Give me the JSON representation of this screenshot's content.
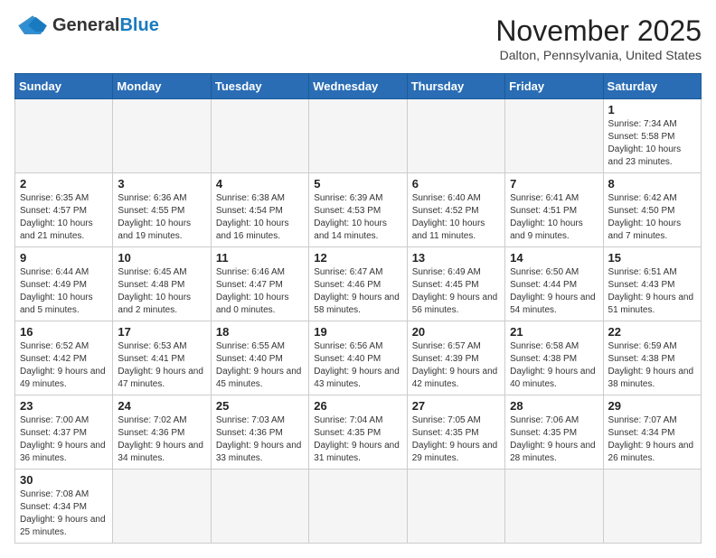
{
  "header": {
    "logo_general": "General",
    "logo_blue": "Blue",
    "month_title": "November 2025",
    "location": "Dalton, Pennsylvania, United States"
  },
  "weekdays": [
    "Sunday",
    "Monday",
    "Tuesday",
    "Wednesday",
    "Thursday",
    "Friday",
    "Saturday"
  ],
  "weeks": [
    [
      {
        "day": "",
        "info": ""
      },
      {
        "day": "",
        "info": ""
      },
      {
        "day": "",
        "info": ""
      },
      {
        "day": "",
        "info": ""
      },
      {
        "day": "",
        "info": ""
      },
      {
        "day": "",
        "info": ""
      },
      {
        "day": "1",
        "info": "Sunrise: 7:34 AM\nSunset: 5:58 PM\nDaylight: 10 hours and 23 minutes."
      }
    ],
    [
      {
        "day": "2",
        "info": "Sunrise: 6:35 AM\nSunset: 4:57 PM\nDaylight: 10 hours and 21 minutes."
      },
      {
        "day": "3",
        "info": "Sunrise: 6:36 AM\nSunset: 4:55 PM\nDaylight: 10 hours and 19 minutes."
      },
      {
        "day": "4",
        "info": "Sunrise: 6:38 AM\nSunset: 4:54 PM\nDaylight: 10 hours and 16 minutes."
      },
      {
        "day": "5",
        "info": "Sunrise: 6:39 AM\nSunset: 4:53 PM\nDaylight: 10 hours and 14 minutes."
      },
      {
        "day": "6",
        "info": "Sunrise: 6:40 AM\nSunset: 4:52 PM\nDaylight: 10 hours and 11 minutes."
      },
      {
        "day": "7",
        "info": "Sunrise: 6:41 AM\nSunset: 4:51 PM\nDaylight: 10 hours and 9 minutes."
      },
      {
        "day": "8",
        "info": "Sunrise: 6:42 AM\nSunset: 4:50 PM\nDaylight: 10 hours and 7 minutes."
      }
    ],
    [
      {
        "day": "9",
        "info": "Sunrise: 6:44 AM\nSunset: 4:49 PM\nDaylight: 10 hours and 5 minutes."
      },
      {
        "day": "10",
        "info": "Sunrise: 6:45 AM\nSunset: 4:48 PM\nDaylight: 10 hours and 2 minutes."
      },
      {
        "day": "11",
        "info": "Sunrise: 6:46 AM\nSunset: 4:47 PM\nDaylight: 10 hours and 0 minutes."
      },
      {
        "day": "12",
        "info": "Sunrise: 6:47 AM\nSunset: 4:46 PM\nDaylight: 9 hours and 58 minutes."
      },
      {
        "day": "13",
        "info": "Sunrise: 6:49 AM\nSunset: 4:45 PM\nDaylight: 9 hours and 56 minutes."
      },
      {
        "day": "14",
        "info": "Sunrise: 6:50 AM\nSunset: 4:44 PM\nDaylight: 9 hours and 54 minutes."
      },
      {
        "day": "15",
        "info": "Sunrise: 6:51 AM\nSunset: 4:43 PM\nDaylight: 9 hours and 51 minutes."
      }
    ],
    [
      {
        "day": "16",
        "info": "Sunrise: 6:52 AM\nSunset: 4:42 PM\nDaylight: 9 hours and 49 minutes."
      },
      {
        "day": "17",
        "info": "Sunrise: 6:53 AM\nSunset: 4:41 PM\nDaylight: 9 hours and 47 minutes."
      },
      {
        "day": "18",
        "info": "Sunrise: 6:55 AM\nSunset: 4:40 PM\nDaylight: 9 hours and 45 minutes."
      },
      {
        "day": "19",
        "info": "Sunrise: 6:56 AM\nSunset: 4:40 PM\nDaylight: 9 hours and 43 minutes."
      },
      {
        "day": "20",
        "info": "Sunrise: 6:57 AM\nSunset: 4:39 PM\nDaylight: 9 hours and 42 minutes."
      },
      {
        "day": "21",
        "info": "Sunrise: 6:58 AM\nSunset: 4:38 PM\nDaylight: 9 hours and 40 minutes."
      },
      {
        "day": "22",
        "info": "Sunrise: 6:59 AM\nSunset: 4:38 PM\nDaylight: 9 hours and 38 minutes."
      }
    ],
    [
      {
        "day": "23",
        "info": "Sunrise: 7:00 AM\nSunset: 4:37 PM\nDaylight: 9 hours and 36 minutes."
      },
      {
        "day": "24",
        "info": "Sunrise: 7:02 AM\nSunset: 4:36 PM\nDaylight: 9 hours and 34 minutes."
      },
      {
        "day": "25",
        "info": "Sunrise: 7:03 AM\nSunset: 4:36 PM\nDaylight: 9 hours and 33 minutes."
      },
      {
        "day": "26",
        "info": "Sunrise: 7:04 AM\nSunset: 4:35 PM\nDaylight: 9 hours and 31 minutes."
      },
      {
        "day": "27",
        "info": "Sunrise: 7:05 AM\nSunset: 4:35 PM\nDaylight: 9 hours and 29 minutes."
      },
      {
        "day": "28",
        "info": "Sunrise: 7:06 AM\nSunset: 4:35 PM\nDaylight: 9 hours and 28 minutes."
      },
      {
        "day": "29",
        "info": "Sunrise: 7:07 AM\nSunset: 4:34 PM\nDaylight: 9 hours and 26 minutes."
      }
    ],
    [
      {
        "day": "30",
        "info": "Sunrise: 7:08 AM\nSunset: 4:34 PM\nDaylight: 9 hours and 25 minutes."
      },
      {
        "day": "",
        "info": ""
      },
      {
        "day": "",
        "info": ""
      },
      {
        "day": "",
        "info": ""
      },
      {
        "day": "",
        "info": ""
      },
      {
        "day": "",
        "info": ""
      },
      {
        "day": "",
        "info": ""
      }
    ]
  ]
}
